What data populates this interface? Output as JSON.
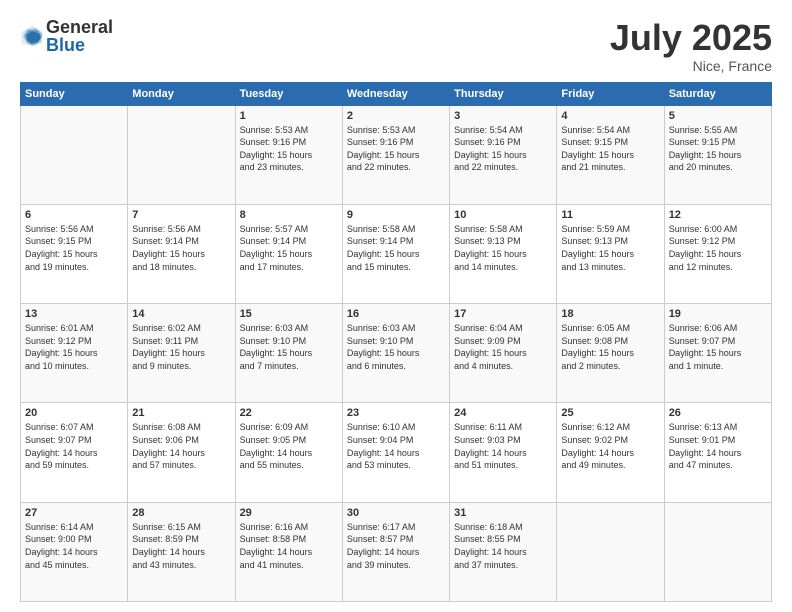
{
  "logo": {
    "general": "General",
    "blue": "Blue"
  },
  "header": {
    "month": "July 2025",
    "location": "Nice, France"
  },
  "weekdays": [
    "Sunday",
    "Monday",
    "Tuesday",
    "Wednesday",
    "Thursday",
    "Friday",
    "Saturday"
  ],
  "weeks": [
    [
      {
        "num": "",
        "info": ""
      },
      {
        "num": "",
        "info": ""
      },
      {
        "num": "1",
        "info": "Sunrise: 5:53 AM\nSunset: 9:16 PM\nDaylight: 15 hours\nand 23 minutes."
      },
      {
        "num": "2",
        "info": "Sunrise: 5:53 AM\nSunset: 9:16 PM\nDaylight: 15 hours\nand 22 minutes."
      },
      {
        "num": "3",
        "info": "Sunrise: 5:54 AM\nSunset: 9:16 PM\nDaylight: 15 hours\nand 22 minutes."
      },
      {
        "num": "4",
        "info": "Sunrise: 5:54 AM\nSunset: 9:15 PM\nDaylight: 15 hours\nand 21 minutes."
      },
      {
        "num": "5",
        "info": "Sunrise: 5:55 AM\nSunset: 9:15 PM\nDaylight: 15 hours\nand 20 minutes."
      }
    ],
    [
      {
        "num": "6",
        "info": "Sunrise: 5:56 AM\nSunset: 9:15 PM\nDaylight: 15 hours\nand 19 minutes."
      },
      {
        "num": "7",
        "info": "Sunrise: 5:56 AM\nSunset: 9:14 PM\nDaylight: 15 hours\nand 18 minutes."
      },
      {
        "num": "8",
        "info": "Sunrise: 5:57 AM\nSunset: 9:14 PM\nDaylight: 15 hours\nand 17 minutes."
      },
      {
        "num": "9",
        "info": "Sunrise: 5:58 AM\nSunset: 9:14 PM\nDaylight: 15 hours\nand 15 minutes."
      },
      {
        "num": "10",
        "info": "Sunrise: 5:58 AM\nSunset: 9:13 PM\nDaylight: 15 hours\nand 14 minutes."
      },
      {
        "num": "11",
        "info": "Sunrise: 5:59 AM\nSunset: 9:13 PM\nDaylight: 15 hours\nand 13 minutes."
      },
      {
        "num": "12",
        "info": "Sunrise: 6:00 AM\nSunset: 9:12 PM\nDaylight: 15 hours\nand 12 minutes."
      }
    ],
    [
      {
        "num": "13",
        "info": "Sunrise: 6:01 AM\nSunset: 9:12 PM\nDaylight: 15 hours\nand 10 minutes."
      },
      {
        "num": "14",
        "info": "Sunrise: 6:02 AM\nSunset: 9:11 PM\nDaylight: 15 hours\nand 9 minutes."
      },
      {
        "num": "15",
        "info": "Sunrise: 6:03 AM\nSunset: 9:10 PM\nDaylight: 15 hours\nand 7 minutes."
      },
      {
        "num": "16",
        "info": "Sunrise: 6:03 AM\nSunset: 9:10 PM\nDaylight: 15 hours\nand 6 minutes."
      },
      {
        "num": "17",
        "info": "Sunrise: 6:04 AM\nSunset: 9:09 PM\nDaylight: 15 hours\nand 4 minutes."
      },
      {
        "num": "18",
        "info": "Sunrise: 6:05 AM\nSunset: 9:08 PM\nDaylight: 15 hours\nand 2 minutes."
      },
      {
        "num": "19",
        "info": "Sunrise: 6:06 AM\nSunset: 9:07 PM\nDaylight: 15 hours\nand 1 minute."
      }
    ],
    [
      {
        "num": "20",
        "info": "Sunrise: 6:07 AM\nSunset: 9:07 PM\nDaylight: 14 hours\nand 59 minutes."
      },
      {
        "num": "21",
        "info": "Sunrise: 6:08 AM\nSunset: 9:06 PM\nDaylight: 14 hours\nand 57 minutes."
      },
      {
        "num": "22",
        "info": "Sunrise: 6:09 AM\nSunset: 9:05 PM\nDaylight: 14 hours\nand 55 minutes."
      },
      {
        "num": "23",
        "info": "Sunrise: 6:10 AM\nSunset: 9:04 PM\nDaylight: 14 hours\nand 53 minutes."
      },
      {
        "num": "24",
        "info": "Sunrise: 6:11 AM\nSunset: 9:03 PM\nDaylight: 14 hours\nand 51 minutes."
      },
      {
        "num": "25",
        "info": "Sunrise: 6:12 AM\nSunset: 9:02 PM\nDaylight: 14 hours\nand 49 minutes."
      },
      {
        "num": "26",
        "info": "Sunrise: 6:13 AM\nSunset: 9:01 PM\nDaylight: 14 hours\nand 47 minutes."
      }
    ],
    [
      {
        "num": "27",
        "info": "Sunrise: 6:14 AM\nSunset: 9:00 PM\nDaylight: 14 hours\nand 45 minutes."
      },
      {
        "num": "28",
        "info": "Sunrise: 6:15 AM\nSunset: 8:59 PM\nDaylight: 14 hours\nand 43 minutes."
      },
      {
        "num": "29",
        "info": "Sunrise: 6:16 AM\nSunset: 8:58 PM\nDaylight: 14 hours\nand 41 minutes."
      },
      {
        "num": "30",
        "info": "Sunrise: 6:17 AM\nSunset: 8:57 PM\nDaylight: 14 hours\nand 39 minutes."
      },
      {
        "num": "31",
        "info": "Sunrise: 6:18 AM\nSunset: 8:55 PM\nDaylight: 14 hours\nand 37 minutes."
      },
      {
        "num": "",
        "info": ""
      },
      {
        "num": "",
        "info": ""
      }
    ]
  ]
}
